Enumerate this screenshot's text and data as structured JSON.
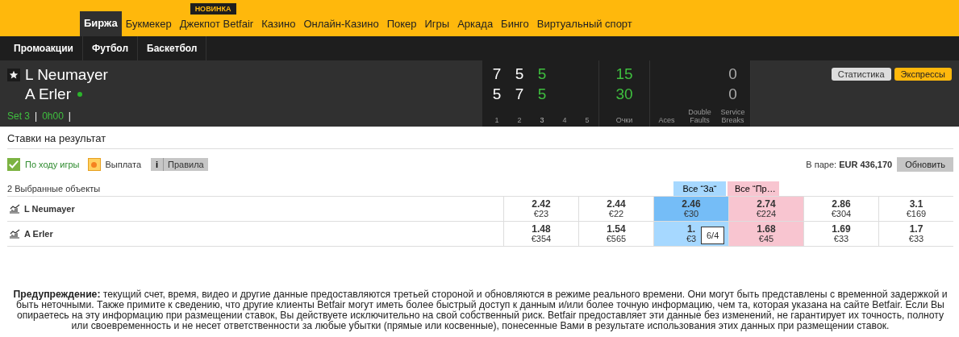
{
  "top_nav": [
    {
      "label": "Биржа",
      "selected": true
    },
    {
      "label": "Букмекер",
      "selected": false
    },
    {
      "label": "Джекпот Betfair",
      "selected": false,
      "badge": "НОВИНКА"
    },
    {
      "label": "Казино",
      "selected": false
    },
    {
      "label": "Онлайн-Казино",
      "selected": false
    },
    {
      "label": "Покер",
      "selected": false
    },
    {
      "label": "Игры",
      "selected": false
    },
    {
      "label": "Аркада",
      "selected": false
    },
    {
      "label": "Бинго",
      "selected": false
    },
    {
      "label": "Виртуальный спорт",
      "selected": false
    }
  ],
  "sub_nav": [
    "Промоакции",
    "Футбол",
    "Баскетбол"
  ],
  "match": {
    "players": [
      {
        "name": "L Neumayer",
        "serving": false
      },
      {
        "name": "A Erler",
        "serving": true
      }
    ],
    "set_label": "Set 3",
    "time": "0h00",
    "sep": "|",
    "sets": [
      {
        "label": "1",
        "scores": [
          "7",
          "5"
        ],
        "current": false
      },
      {
        "label": "2",
        "scores": [
          "5",
          "7"
        ],
        "current": false
      },
      {
        "label": "3",
        "scores": [
          "5",
          "5"
        ],
        "current": true
      },
      {
        "label": "4",
        "current": false
      },
      {
        "label": "5",
        "current": false
      }
    ],
    "points": {
      "label": "Очки",
      "scores": [
        "15",
        "30"
      ]
    },
    "stats": [
      {
        "label": "Aces"
      },
      {
        "label": "Double Faults"
      },
      {
        "label": "Service Breaks",
        "scores": [
          "0",
          "0"
        ]
      }
    ],
    "buttons": [
      {
        "label": "Статистика",
        "kind": "grey"
      },
      {
        "label": "Экспрессы",
        "kind": "yellow"
      }
    ]
  },
  "market": {
    "title": "Ставки на результат",
    "inplay": {
      "label": "По ходу игры",
      "checked": true
    },
    "payout": "Выплата",
    "rules": {
      "icon": "i",
      "label": "Правила"
    },
    "matched_label": "В паре:",
    "matched": "EUR 436,170",
    "refresh": "Обновить",
    "selections_count": "2 Выбранные объекты",
    "back_all": "Все “За“",
    "lay_all": "Все “Пр…",
    "runners": [
      {
        "name": "L Neumayer",
        "prices": [
          {
            "odds": "2.42",
            "stake": "€23",
            "kind": "back",
            "best": false,
            "hover": false
          },
          {
            "odds": "2.44",
            "stake": "€22",
            "kind": "back",
            "best": false,
            "hover": false
          },
          {
            "odds": "2.46",
            "stake": "€30",
            "kind": "back",
            "best": true,
            "hover": false
          },
          {
            "odds": "2.74",
            "stake": "€224",
            "kind": "lay",
            "best": true,
            "hover": false
          },
          {
            "odds": "2.86",
            "stake": "€304",
            "kind": "lay",
            "best": false,
            "hover": false
          },
          {
            "odds": "3.1",
            "stake": "€169",
            "kind": "lay",
            "best": false,
            "hover": false
          }
        ]
      },
      {
        "name": "A Erler",
        "prices": [
          {
            "odds": "1.48",
            "stake": "€354",
            "kind": "back",
            "best": false,
            "hover": false
          },
          {
            "odds": "1.54",
            "stake": "€565",
            "kind": "back",
            "best": false,
            "hover": false
          },
          {
            "odds": "1.",
            "stake": "€3",
            "kind": "back",
            "best": true,
            "hover": true,
            "tooltip": "6/4"
          },
          {
            "odds": "1.68",
            "stake": "€45",
            "kind": "lay",
            "best": true,
            "hover": false
          },
          {
            "odds": "1.69",
            "stake": "€33",
            "kind": "lay",
            "best": false,
            "hover": false
          },
          {
            "odds": "1.7",
            "stake": "€33",
            "kind": "lay",
            "best": false,
            "hover": false
          }
        ]
      }
    ]
  },
  "warning": "**Предупреждение:** текущий счет, время, видео и другие данные предоставляются третьей стороной и обновляются в режиме реального времени. Они могут быть представлены с временной задержкой и быть неточными.  Также примите к сведению, что другие клиенты Betfair могут иметь более быстрый доступ к данным и/или более точную информацию, чем та, которая указана на сайте Betfair. Если Вы опираетесь на эту информацию при размещении ставок, Вы действуете исключительно на свой собственный риск. Betfair предоставляет эти данные без изменений, не гарантирует их точность, полноту или своевременность и не несет ответственности за любые убытки (прямые или косвенные), понесенные Вами в результате использования этих данных при размещении ставок."
}
